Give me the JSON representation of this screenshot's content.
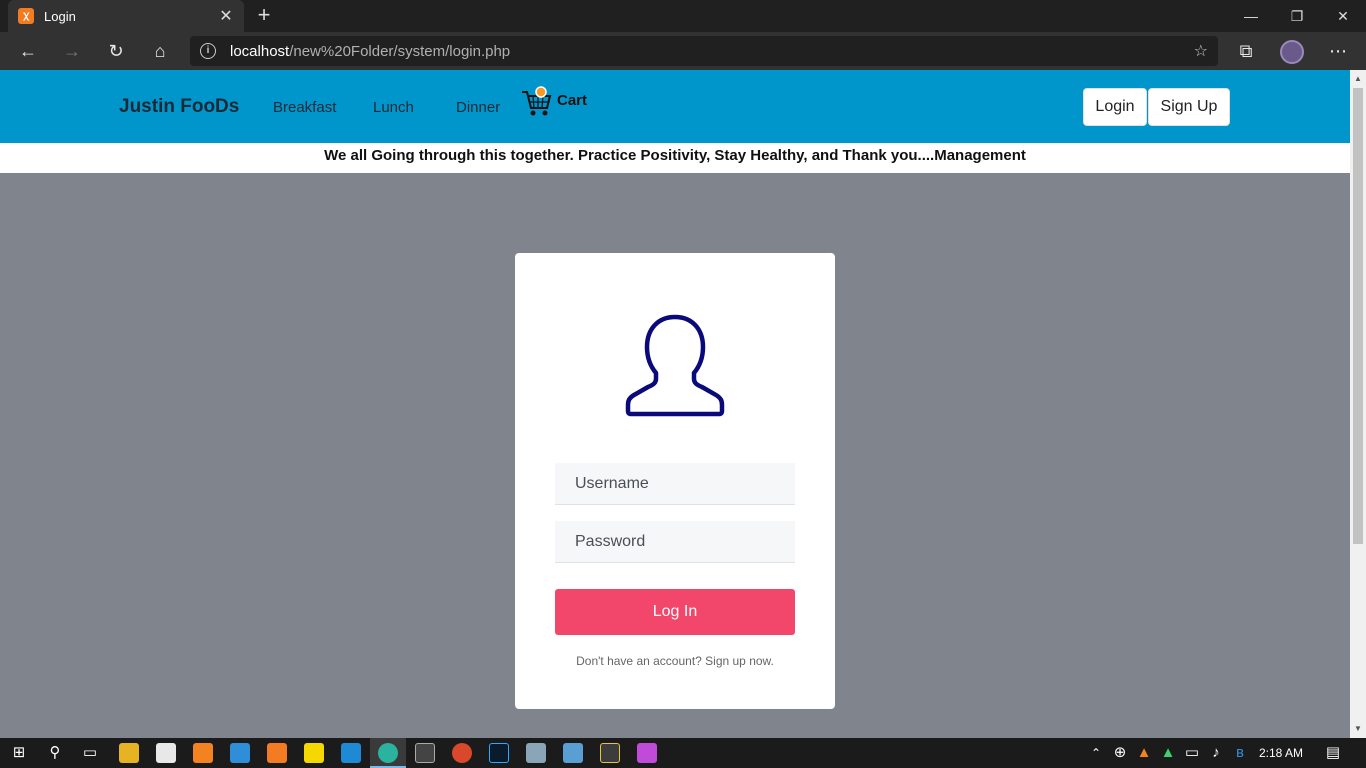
{
  "browser": {
    "tab_title": "Login",
    "tab_favicon": "xampp-icon",
    "url_host": "localhost",
    "url_path": "/new%20Folder/system/login.php"
  },
  "site": {
    "brand": "Justin FooDs",
    "nav": [
      "Breakfast",
      "Lunch",
      "Dinner"
    ],
    "cart_label": "Cart",
    "login_label": "Login",
    "signup_label": "Sign Up",
    "announcement": "We all Going through this together. Practice Positivity, Stay Healthy, and Thank you....Management"
  },
  "login_form": {
    "username_placeholder": "Username",
    "password_placeholder": "Password",
    "submit_label": "Log In",
    "signup_note": "Don't have an account? Sign up now."
  },
  "taskbar": {
    "time": "2:18 AM"
  },
  "colors": {
    "header": "#0096cc",
    "button": "#f2476a",
    "user_icon": "#0a0a7a",
    "page_bg": "#80848c"
  }
}
